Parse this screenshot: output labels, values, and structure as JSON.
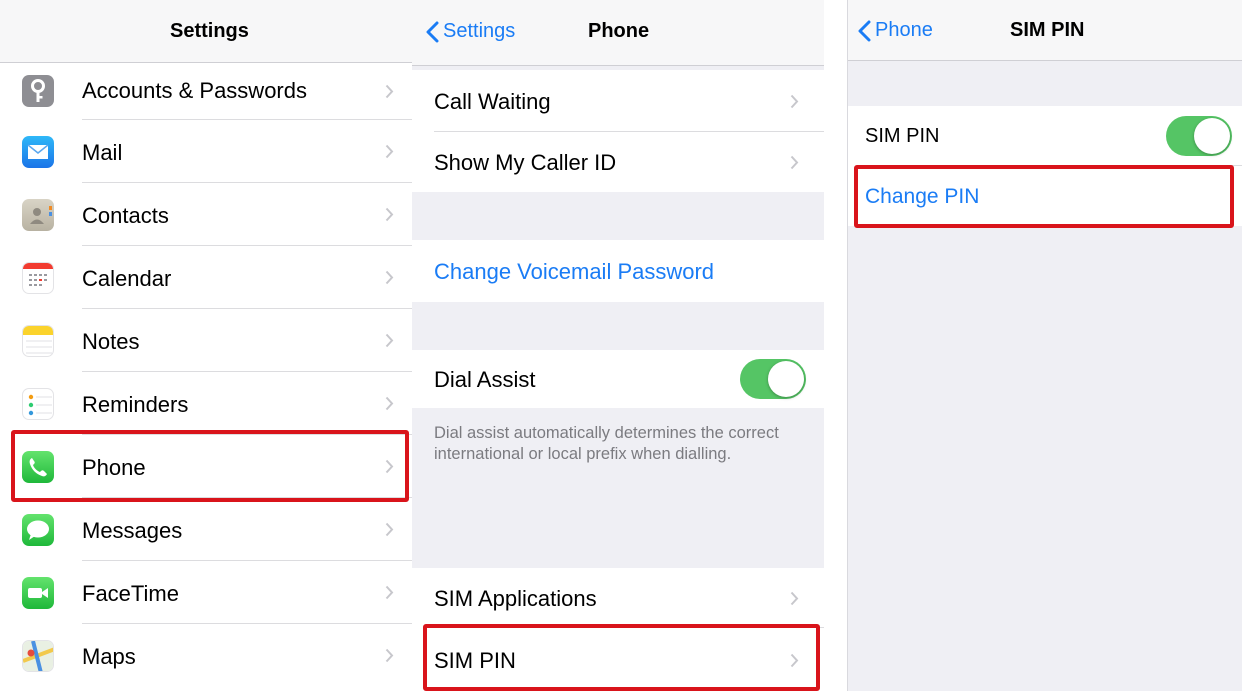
{
  "settings": {
    "title": "Settings",
    "items": [
      {
        "label": "Accounts & Passwords",
        "icon": "key-icon"
      },
      {
        "label": "Mail",
        "icon": "mail-icon"
      },
      {
        "label": "Contacts",
        "icon": "contacts-icon"
      },
      {
        "label": "Calendar",
        "icon": "calendar-icon"
      },
      {
        "label": "Notes",
        "icon": "notes-icon"
      },
      {
        "label": "Reminders",
        "icon": "reminders-icon"
      },
      {
        "label": "Phone",
        "icon": "phone-icon"
      },
      {
        "label": "Messages",
        "icon": "messages-icon"
      },
      {
        "label": "FaceTime",
        "icon": "facetime-icon"
      },
      {
        "label": "Maps",
        "icon": "maps-icon"
      }
    ]
  },
  "phone": {
    "back_label": "Settings",
    "title": "Phone",
    "call_waiting": "Call Waiting",
    "show_caller_id": "Show My Caller ID",
    "change_voicemail_password": "Change Voicemail Password",
    "dial_assist": "Dial Assist",
    "dial_assist_on": true,
    "dial_assist_footer": "Dial assist automatically determines the correct international or local prefix when dialling.",
    "sim_applications": "SIM Applications",
    "sim_pin": "SIM PIN"
  },
  "sim_pin": {
    "back_label": "Phone",
    "title": "SIM PIN",
    "sim_pin_label": "SIM PIN",
    "sim_pin_on": true,
    "change_pin": "Change PIN"
  },
  "colors": {
    "ios_blue": "#1a7cf5",
    "toggle_green": "#55c565",
    "highlight_red": "#d9141b",
    "group_background": "#efeff4"
  }
}
